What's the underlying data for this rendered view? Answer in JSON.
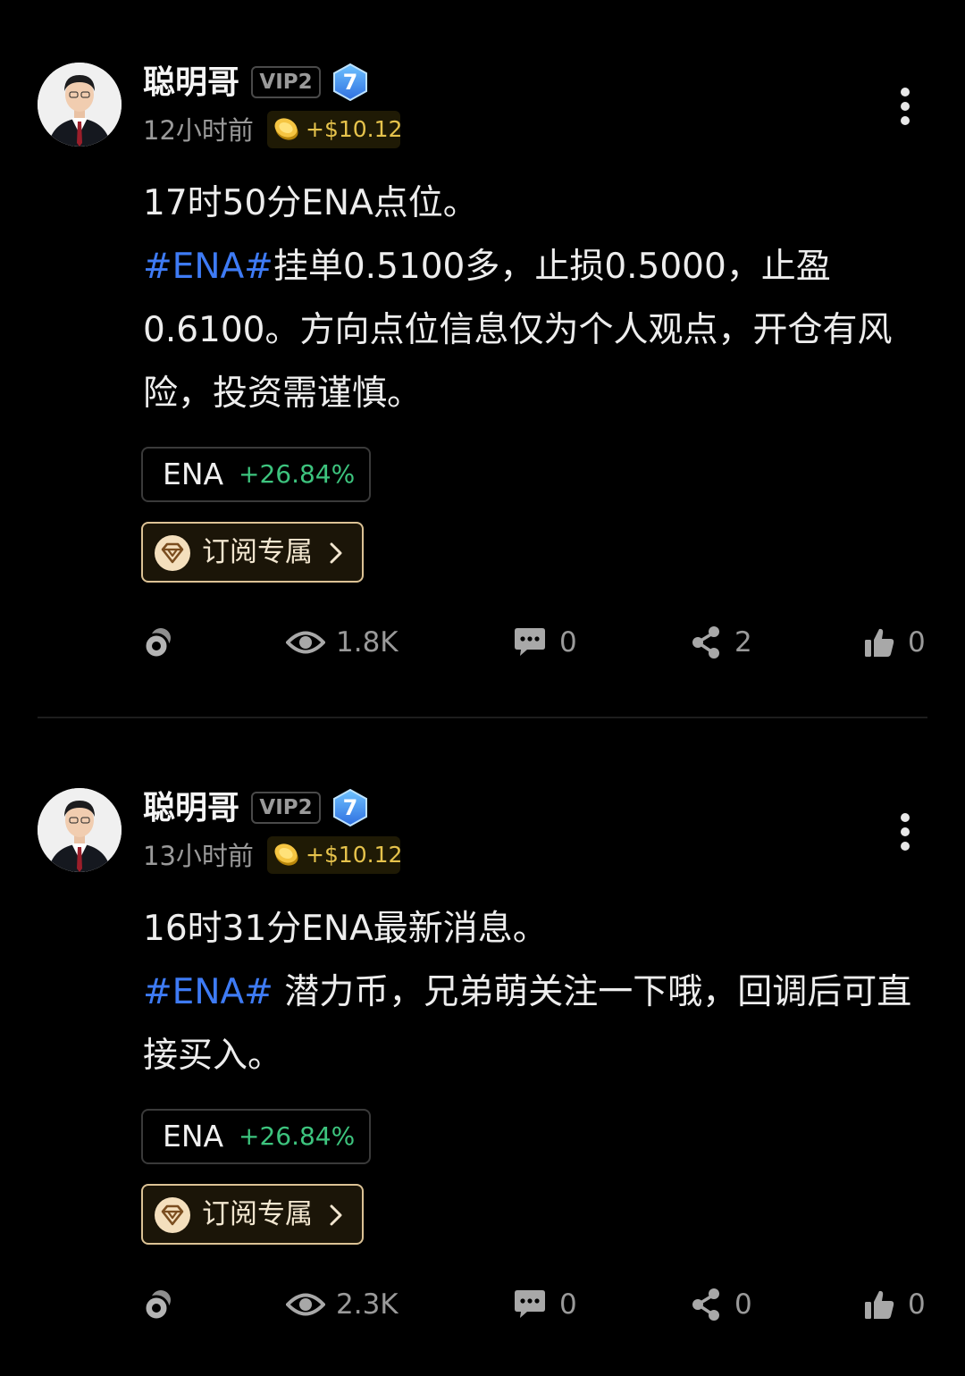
{
  "posts": [
    {
      "author": "聪明哥",
      "vip_badge": "VIP2",
      "level": "7",
      "time": "12小时前",
      "earnings": "+$10.12",
      "lines": [
        {
          "text": "17时50分ENA点位。"
        },
        {
          "hashtag": "#ENA#",
          "text": "挂单0.5100多，止损0.5000，止盈0.6100。方向点位信息仅为个人观点，开仓有风险，投资需谨慎。"
        }
      ],
      "ticker": {
        "symbol": "ENA",
        "change": "+26.84%"
      },
      "subscribe_label": "订阅专属",
      "stats": {
        "views": "1.8K",
        "comments": "0",
        "shares": "2",
        "likes": "0"
      }
    },
    {
      "author": "聪明哥",
      "vip_badge": "VIP2",
      "level": "7",
      "time": "13小时前",
      "earnings": "+$10.12",
      "lines": [
        {
          "text": "16时31分ENA最新消息。"
        },
        {
          "hashtag": "#ENA#",
          "text": " 潜力币，兄弟萌关注一下哦，回调后可直接买入。"
        }
      ],
      "ticker": {
        "symbol": "ENA",
        "change": "+26.84%"
      },
      "subscribe_label": "订阅专属",
      "stats": {
        "views": "2.3K",
        "comments": "0",
        "shares": "0",
        "likes": "0"
      }
    }
  ],
  "icons": {
    "tip": "tip-coin-icon",
    "views": "eye-icon",
    "comments": "comment-icon",
    "shares": "share-icon",
    "likes": "thumbs-up-icon",
    "more": "more-vertical-icon",
    "subscribe": "diamond-badge-icon",
    "level": "level-shield-icon",
    "earnings": "coin-icon"
  },
  "colors": {
    "background": "#000000",
    "hashtag": "#3e7bf5",
    "gain": "#3dc47e",
    "earnings": "#e6c34c",
    "subscribe_border": "#dcc295",
    "level_badge": "#3d8cf0"
  }
}
